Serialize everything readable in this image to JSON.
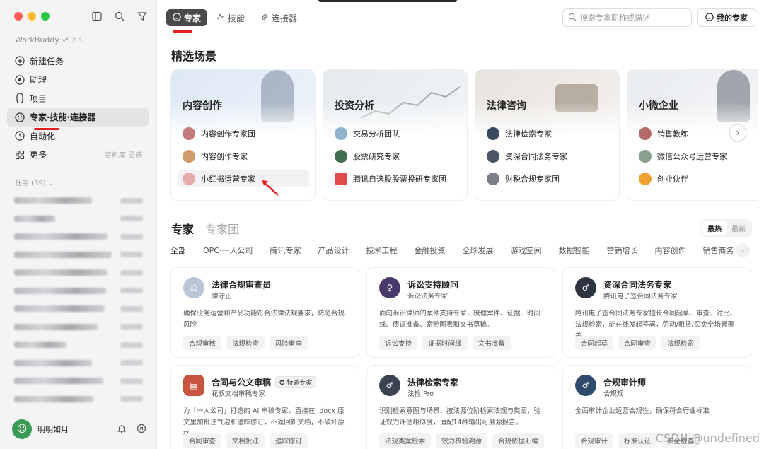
{
  "sidebar": {
    "brand": "WorkBuddy",
    "version": "v5.2.6",
    "nav": [
      {
        "label": "新建任务",
        "icon": "plus-circle-icon"
      },
      {
        "label": "助理",
        "icon": "assistant-icon"
      },
      {
        "label": "项目",
        "icon": "project-icon"
      },
      {
        "label": "专家·技能·连接器",
        "icon": "expert-icon",
        "active": true
      },
      {
        "label": "自动化",
        "icon": "clock-icon"
      },
      {
        "label": "更多",
        "icon": "grid-icon",
        "extra": "资料库·灵感"
      }
    ],
    "tasks_header": "任务 (39)",
    "user": {
      "name": "明明如月"
    }
  },
  "tabs": [
    {
      "label": "专家",
      "active": true
    },
    {
      "label": "技能"
    },
    {
      "label": "连接器"
    }
  ],
  "search": {
    "placeholder": "搜索专家职称或描述"
  },
  "my_experts": "我的专家",
  "featured": {
    "title": "精选场景",
    "scenes": [
      {
        "title": "内容创作",
        "items": [
          "内容创作专家团",
          "内容创作专家",
          "小红书运营专家"
        ]
      },
      {
        "title": "投资分析",
        "items": [
          "交易分析团队",
          "股票研究专家",
          "腾讯自选股股票投研专家团"
        ]
      },
      {
        "title": "法律咨询",
        "items": [
          "法律检索专家",
          "资深合同法务专家",
          "财税合规专家团"
        ]
      },
      {
        "title": "小微企业",
        "items": [
          "销售教练",
          "微信公众号运营专家",
          "创业伙伴"
        ]
      }
    ]
  },
  "experts": {
    "title": "专家",
    "title2": "专家团",
    "sort": [
      "最热",
      "最新"
    ],
    "categories": [
      "全部",
      "OPC·一人公司",
      "腾讯专家",
      "产品设计",
      "技术工程",
      "金融投资",
      "全球发展",
      "游戏空间",
      "数据智能",
      "营销增长",
      "内容创作",
      "销售商务"
    ],
    "cards": [
      {
        "name": "法律合规审查员",
        "sub": "律守正",
        "desc": "确保业务运营和产品功能符合法律法规要求，防范合规风险",
        "tags": [
          "合规审核",
          "法规检查",
          "风险审查"
        ]
      },
      {
        "name": "诉讼支持顾问",
        "sub": "诉讼法务专家",
        "desc": "面向诉讼律师的案件支持专家，梳理案件、证据、时间线、质证准备、索赔图表和文书草稿。",
        "tags": [
          "诉讼支持",
          "证据时间线",
          "文书准备"
        ]
      },
      {
        "name": "资深合同法务专家",
        "sub": "腾讯电子签合同法务专家",
        "desc": "腾讯电子签合同法务专家擅长合同起草、审查、对比、法规检索，能在线发起签署，劳动/租赁/买卖全场景覆盖",
        "tags": [
          "合同起草",
          "合同审查",
          "法规检索"
        ]
      },
      {
        "name": "合同与公文审稿",
        "badge": "特邀专家",
        "sub": "花叔文档审稿专家",
        "desc": "为「一人公司」打造的 AI 审稿专家。直接在 .docx 原文里加批注气泡和追踪修订，不返回新文档，不破坏原格...",
        "tags": [
          "合同审查",
          "文档批注",
          "追踪修订"
        ]
      },
      {
        "name": "法律检索专家",
        "sub": "法检 Pro",
        "desc": "识别检索意图与场景，按法源位阶检索法规与类案，验证效力评估相似度，适配14种输出可溯源报告。",
        "tags": [
          "法规类案检索",
          "效力核验溯源",
          "合规依据汇编"
        ]
      },
      {
        "name": "合规审计师",
        "sub": "合规规",
        "desc": "全面审计企业运营合规性，确保符合行业标准",
        "tags": [
          "合规审计",
          "标准认证",
          "安全检查"
        ]
      }
    ]
  },
  "watermark": "CSDN @undefined"
}
